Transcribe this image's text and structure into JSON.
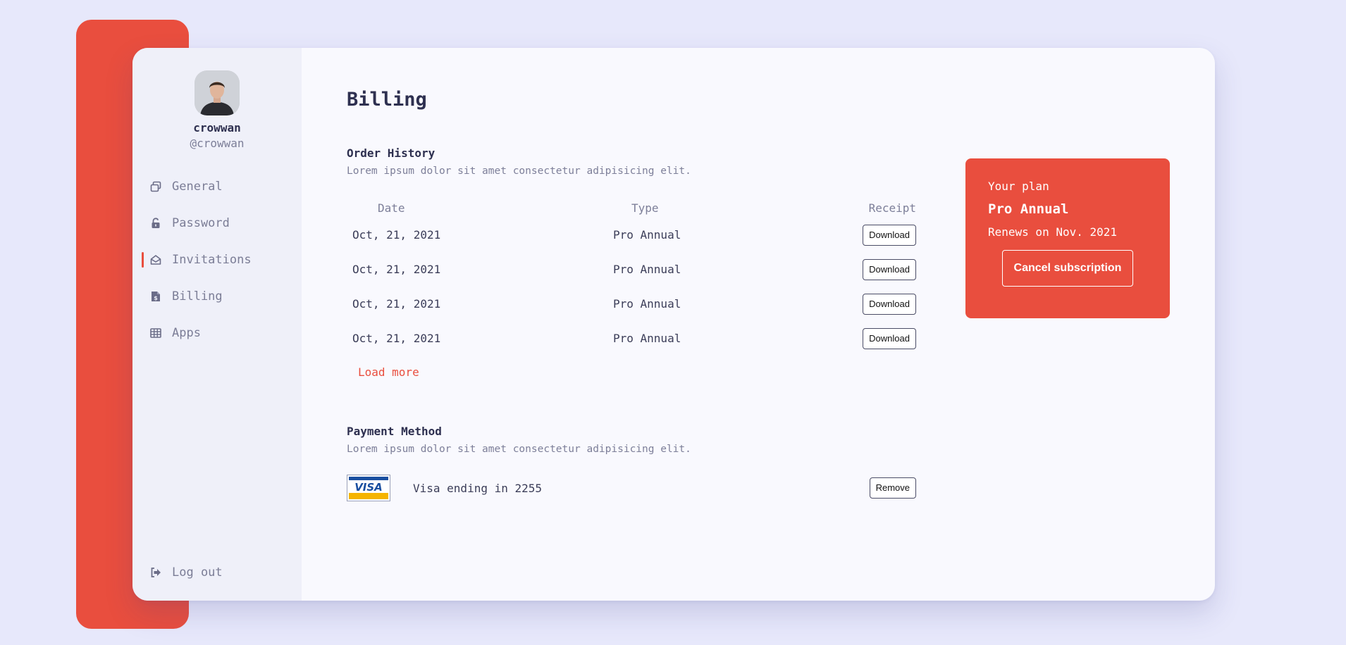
{
  "profile": {
    "name": "crowwan",
    "handle": "@crowwan"
  },
  "sidebar": {
    "items": [
      {
        "label": "General",
        "icon": "window-icon"
      },
      {
        "label": "Password",
        "icon": "lock-icon"
      },
      {
        "label": "Invitations",
        "icon": "envelope-open-icon",
        "active": true
      },
      {
        "label": "Billing",
        "icon": "file-invoice-dollar-icon"
      },
      {
        "label": "Apps",
        "icon": "grid-table-icon"
      }
    ],
    "logout_label": "Log out"
  },
  "page": {
    "title": "Billing"
  },
  "order_history": {
    "title": "Order History",
    "description": "Lorem ipsum dolor sit amet consectetur adipisicing elit.",
    "columns": [
      "Date",
      "Type",
      "Receipt"
    ],
    "rows": [
      {
        "date": "Oct, 21, 2021",
        "type": "Pro Annual",
        "receipt": "Download"
      },
      {
        "date": "Oct, 21, 2021",
        "type": "Pro Annual",
        "receipt": "Download"
      },
      {
        "date": "Oct, 21, 2021",
        "type": "Pro Annual",
        "receipt": "Download"
      },
      {
        "date": "Oct, 21, 2021",
        "type": "Pro Annual",
        "receipt": "Download"
      }
    ],
    "load_more": "Load more"
  },
  "payment_method": {
    "title": "Payment Method",
    "description": "Lorem ipsum dolor sit amet consectetur adipisicing elit.",
    "card_brand": "VISA",
    "card_label": "Visa ending in 2255",
    "remove_label": "Remove"
  },
  "plan": {
    "label": "Your plan",
    "name": "Pro Annual",
    "renews": "Renews on Nov. 2021",
    "cancel_label": "Cancel subscription"
  },
  "colors": {
    "accent": "#e94e3e",
    "background": "#e7e8fb",
    "card": "#f9f9fe",
    "sidebar": "#eff0f9",
    "text_dark": "#2e3050",
    "text_muted": "#7d7f99"
  }
}
